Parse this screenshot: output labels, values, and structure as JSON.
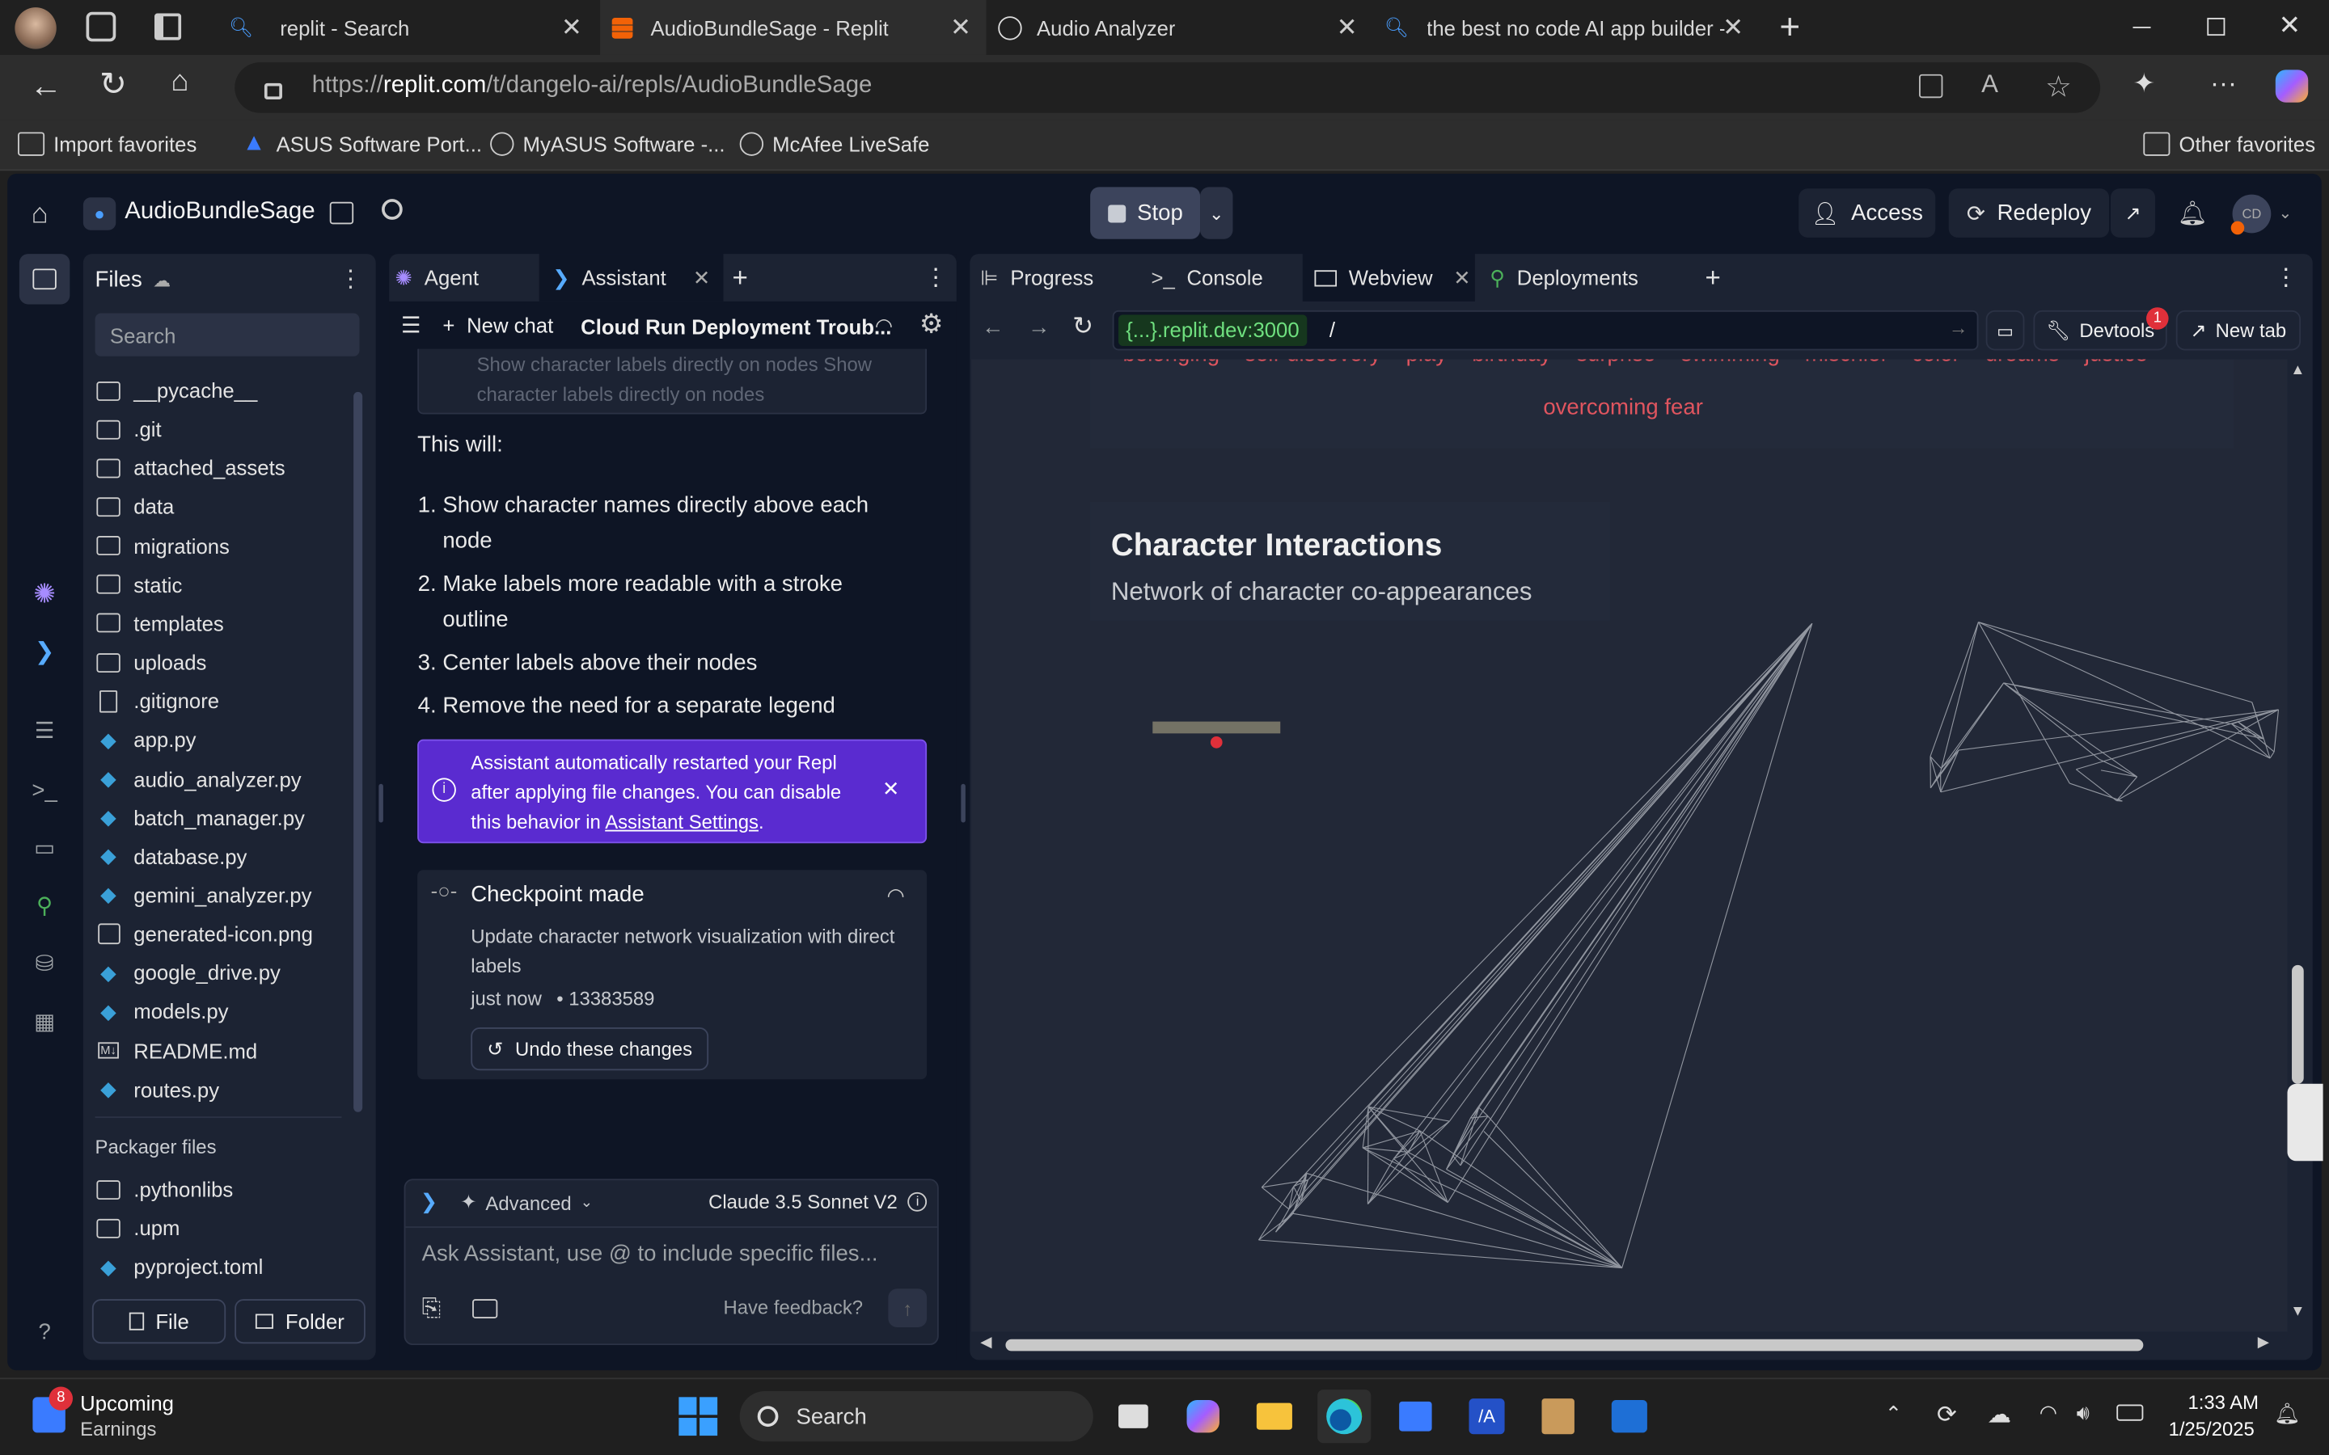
{
  "browser": {
    "tabs": [
      {
        "title": "replit - Search",
        "icon": "search-icon"
      },
      {
        "title": "AudioBundleSage - Replit",
        "icon": "replit-icon",
        "active": true
      },
      {
        "title": "Audio Analyzer",
        "icon": "globe-icon"
      },
      {
        "title": "the best no code AI app builder -",
        "icon": "search-icon"
      }
    ],
    "url_prefix": "https://",
    "url_host": "replit.com",
    "url_path": "/t/dangelo-ai/repls/AudioBundleSage",
    "favorites": [
      "Import favorites",
      "ASUS Software Port...",
      "MyASUS Software -...",
      "McAfee LiveSafe"
    ],
    "other_favorites": "Other favorites"
  },
  "replit": {
    "project_name": "AudioBundleSage",
    "stop_label": "Stop",
    "access_label": "Access",
    "redeploy_label": "Redeploy",
    "avatar_initials": "CD"
  },
  "files": {
    "title": "Files",
    "search_placeholder": "Search",
    "items": [
      {
        "name": "__pycache__",
        "type": "folder"
      },
      {
        "name": ".git",
        "type": "folder"
      },
      {
        "name": "attached_assets",
        "type": "folder"
      },
      {
        "name": "data",
        "type": "folder"
      },
      {
        "name": "migrations",
        "type": "folder"
      },
      {
        "name": "static",
        "type": "folder"
      },
      {
        "name": "templates",
        "type": "folder"
      },
      {
        "name": "uploads",
        "type": "folder"
      },
      {
        "name": ".gitignore",
        "type": "file"
      },
      {
        "name": "app.py",
        "type": "python"
      },
      {
        "name": "audio_analyzer.py",
        "type": "python"
      },
      {
        "name": "batch_manager.py",
        "type": "python"
      },
      {
        "name": "database.py",
        "type": "python"
      },
      {
        "name": "gemini_analyzer.py",
        "type": "python"
      },
      {
        "name": "generated-icon.png",
        "type": "image"
      },
      {
        "name": "google_drive.py",
        "type": "python"
      },
      {
        "name": "models.py",
        "type": "python"
      },
      {
        "name": "README.md",
        "type": "markdown"
      },
      {
        "name": "routes.py",
        "type": "python"
      }
    ],
    "packager_title": "Packager files",
    "packager_items": [
      {
        "name": ".pythonlibs",
        "type": "folder"
      },
      {
        "name": ".upm",
        "type": "folder"
      },
      {
        "name": "pyproject.toml",
        "type": "python"
      }
    ],
    "new_file_label": "File",
    "new_folder_label": "Folder"
  },
  "chat": {
    "tabs": [
      "Agent",
      "Assistant"
    ],
    "new_chat_label": "New chat",
    "chat_title": "Cloud Run Deployment Troub...",
    "faded_text": "Show character labels directly on nodes Show character labels directly on nodes",
    "intro": "This will:",
    "steps": [
      "Show character names directly above each node",
      "Make labels more readable with a stroke outline",
      "Center labels above their nodes",
      "Remove the need for a separate legend"
    ],
    "notice_text": "Assistant automatically restarted your Repl after applying file changes. You can disable this behavior in",
    "notice_link": "Assistant Settings",
    "checkpoint_title": "Checkpoint made",
    "checkpoint_desc": "Update character network visualization with direct labels",
    "checkpoint_time": "just now",
    "checkpoint_id": "• 13383589",
    "undo_label": "Undo these changes",
    "mode_label": "Advanced",
    "model_label": "Claude 3.5 Sonnet V2",
    "input_placeholder": "Ask Assistant, use @ to include specific files...",
    "feedback_label": "Have feedback?"
  },
  "preview": {
    "tabs": [
      "Progress",
      "Console",
      "Webview",
      "Deployments"
    ],
    "url_host": "{...}.replit.dev:3000",
    "url_path": "/",
    "devtools_label": "Devtools",
    "devtools_badge": "1",
    "new_tab_label": "New tab",
    "theme_tags": [
      "belonging",
      "self-discovery",
      "play",
      "birthday",
      "surprise",
      "swimming",
      "mischief",
      "color",
      "dreams",
      "justice"
    ],
    "last_tag": "overcoming fear",
    "section_title": "Character Interactions",
    "section_subtitle": "Network of character co-appearances"
  },
  "taskbar": {
    "widget_title": "Upcoming",
    "widget_sub": "Earnings",
    "widget_badge": "8",
    "search_label": "Search",
    "time": "1:33 AM",
    "date": "1/25/2025"
  },
  "colors": {
    "accent": "#0079f2",
    "notice": "#5a2bd0",
    "tag": "#e0555f",
    "bg": "#0e1525",
    "panel": "#1c2333"
  }
}
